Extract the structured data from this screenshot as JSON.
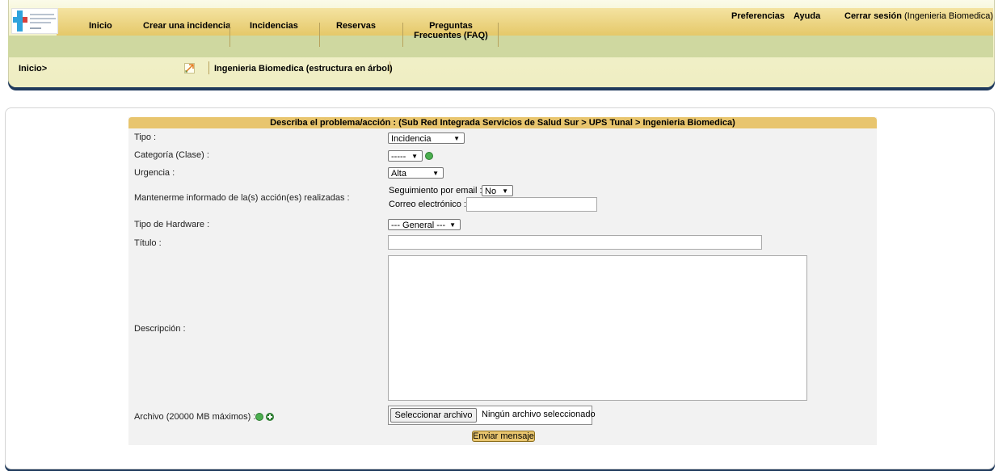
{
  "nav": {
    "inicio": "Inicio",
    "crear": "Crear una incidencia",
    "incidencias": "Incidencias",
    "reservas": "Reservas",
    "faq_line1": "Preguntas",
    "faq_line2": "Frecuentes (FAQ)"
  },
  "toplinks": {
    "preferencias": "Preferencias",
    "ayuda": "Ayuda",
    "logout_prefix": "Cerrar sesión",
    "logout_user": "(Ingenieria Biomedica)"
  },
  "breadcrumb": "Inicio>",
  "tree_label": "Ingenieria Biomedica (estructura en árbol)",
  "form": {
    "title": "Describa el problema/acción : (Sub Red Integrada Servicios de Salud Sur > UPS Tunal > Ingenieria Biomedica)",
    "tipo_label": "Tipo :",
    "tipo_value": "Incidencia",
    "categoria_label": "Categoría (Clase) :",
    "categoria_value": "-----",
    "urgencia_label": "Urgencia :",
    "urgencia_value": "Alta",
    "informado_label": "Mantenerme informado de la(s) acción(es) realizadas :",
    "seguimiento_label": "Seguimiento por email :",
    "seguimiento_value": "No",
    "correo_label": "Correo electrónico :",
    "hardware_label": "Tipo de Hardware :",
    "hardware_value": "--- General ---",
    "titulo_label": "Título :",
    "descripcion_label": "Descripción :",
    "archivo_label": "Archivo (20000 MB máximos) :",
    "file_button": "Seleccionar archivo",
    "file_status": "Ningún archivo seleccionado",
    "submit": "Enviar mensaje"
  },
  "icons": {
    "arrow": "▼"
  }
}
